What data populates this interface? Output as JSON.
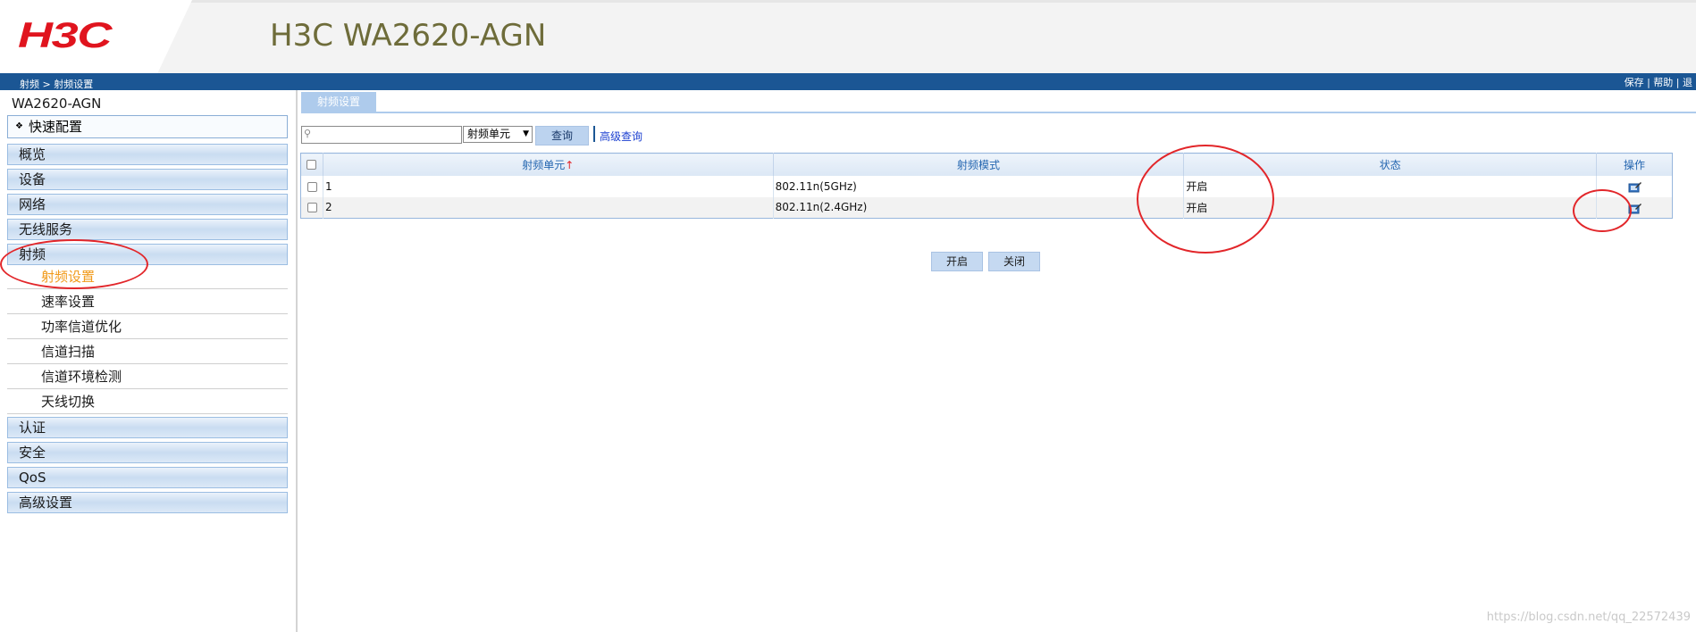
{
  "header": {
    "logo": "H3C",
    "title": "H3C WA2620-AGN"
  },
  "bluebar": {
    "breadcrumb": "射频 > 射频设置",
    "links": [
      "保存",
      "帮助",
      "退"
    ],
    "separator": " | "
  },
  "sidebar": {
    "device": "WA2620-AGN",
    "quick_config": "快速配置",
    "groups_top": [
      "概览",
      "设备",
      "网络",
      "无线服务",
      "射频"
    ],
    "sub_items": [
      "射频设置",
      "速率设置",
      "功率信道优化",
      "信道扫描",
      "信道环境检测",
      "天线切换"
    ],
    "active_sub": "射频设置",
    "groups_bottom": [
      "认证",
      "安全",
      "QoS",
      "高级设置"
    ]
  },
  "main": {
    "tab": "射频设置",
    "search": {
      "value": "",
      "placeholder": ""
    },
    "select_value": "射频单元",
    "query_button": "查询",
    "advanced_link": "高级查询",
    "table": {
      "headers": [
        "射频单元",
        "射频模式",
        "状态",
        "操作"
      ],
      "sort_indicator": "↑",
      "rows": [
        {
          "unit": "1",
          "mode": "802.11n(5GHz)",
          "status": "开启"
        },
        {
          "unit": "2",
          "mode": "802.11n(2.4GHz)",
          "status": "开启"
        }
      ]
    },
    "buttons": {
      "enable": "开启",
      "disable": "关闭"
    }
  },
  "watermark": "https://blog.csdn.net/qq_22572439",
  "colors": {
    "brand_red": "#e0141e",
    "bar_blue": "#1b5694",
    "annotation_red": "#e2262a",
    "active_orange": "#f19a1a"
  }
}
